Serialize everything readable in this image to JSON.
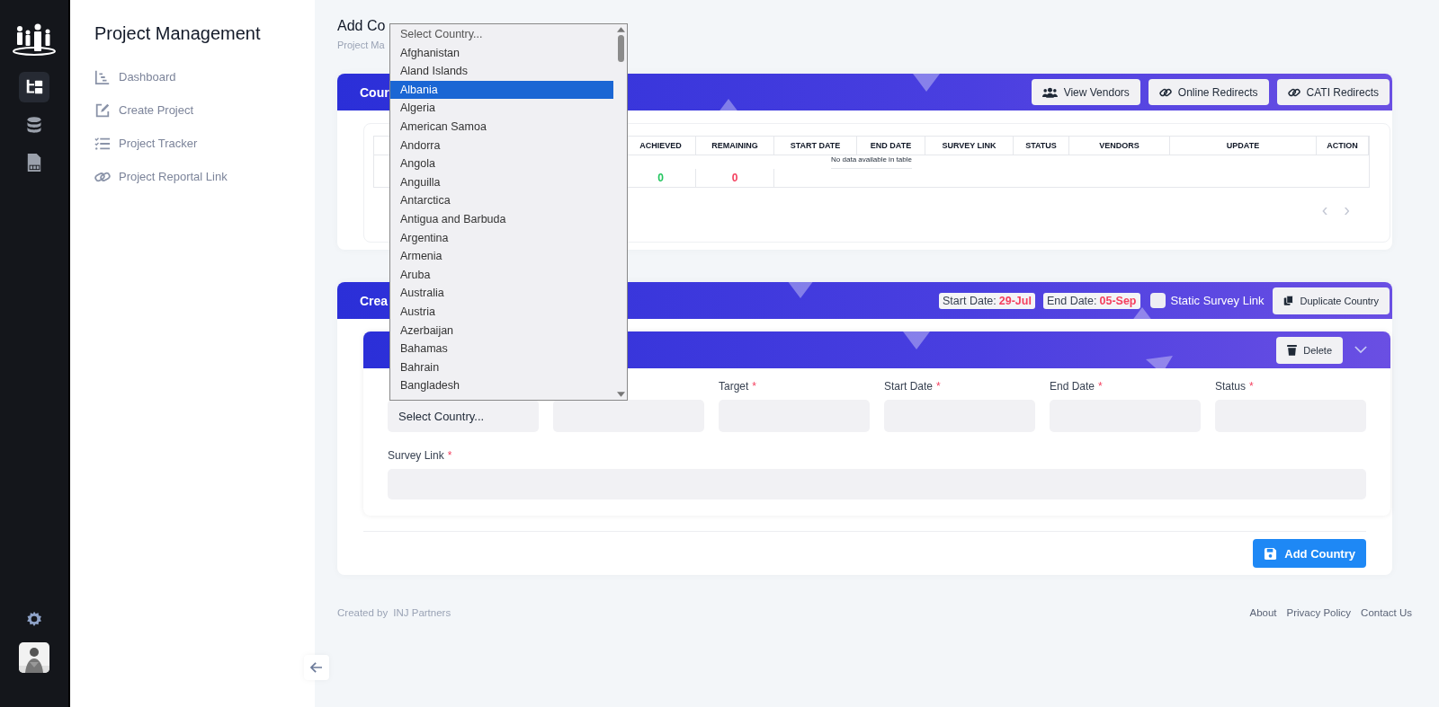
{
  "rail": {
    "items": [
      {
        "kind": "sitemap",
        "selected": true
      },
      {
        "kind": "database",
        "selected": false
      },
      {
        "kind": "pdf",
        "selected": false
      }
    ]
  },
  "sidebar": {
    "title": "Project Management",
    "items": [
      {
        "kind": "dashboard",
        "label": "Dashboard"
      },
      {
        "kind": "edit",
        "label": "Create Project"
      },
      {
        "kind": "tracker",
        "label": "Project Tracker"
      },
      {
        "kind": "link",
        "label": "Project Reportal Link"
      }
    ]
  },
  "page": {
    "title": "Add Co",
    "breadcrumb": "Project Ma"
  },
  "country_card": {
    "title": "Cour",
    "buttons": [
      {
        "kind": "users",
        "label": "View Vendors"
      },
      {
        "kind": "link",
        "label": "Online Redirects"
      },
      {
        "kind": "link",
        "label": "CATI Redirects"
      }
    ],
    "table": {
      "columns": [
        "",
        "ACHIEVED",
        "REMAINING",
        "START DATE",
        "END DATE",
        "SURVEY LINK",
        "STATUS",
        "VENDORS",
        "UPDATE",
        "ACTION"
      ],
      "empty_message": "No data available in table",
      "totals": [
        {
          "value": "0",
          "color": "#22c55e"
        },
        {
          "value": "0",
          "color": "#f43f5e"
        }
      ]
    },
    "pager": {
      "prev": "‹",
      "next": "›"
    }
  },
  "create_card": {
    "title": "Crea",
    "start_date": {
      "label": "Start Date:",
      "value": "29-Jul"
    },
    "end_date": {
      "label": "End Date:",
      "value": "05-Sep"
    },
    "static_link": {
      "label": "Static Survey Link",
      "checked": false
    },
    "duplicate_button": "Duplicate Country",
    "section": {
      "delete_button": "Delete",
      "fields": [
        {
          "kind": "select",
          "value": "Select Country..."
        },
        {
          "kind": "text"
        },
        {
          "kind": "text",
          "label": "Target",
          "required": "*"
        },
        {
          "kind": "date",
          "label": "Start Date",
          "required": "*"
        },
        {
          "kind": "date",
          "label": "End Date",
          "required": "*"
        },
        {
          "kind": "select",
          "label": "Status",
          "required": "*"
        }
      ],
      "survey_link": {
        "label": "Survey Link",
        "required": "*"
      }
    },
    "add_button": "Add Country"
  },
  "country_dropdown": {
    "options": [
      {
        "label": "Select Country...",
        "selected": false
      },
      {
        "label": "Afghanistan",
        "selected": false
      },
      {
        "label": "Aland Islands",
        "selected": false
      },
      {
        "label": "Albania",
        "selected": true
      },
      {
        "label": "Algeria",
        "selected": false
      },
      {
        "label": "American Samoa",
        "selected": false
      },
      {
        "label": "Andorra",
        "selected": false
      },
      {
        "label": "Angola",
        "selected": false
      },
      {
        "label": "Anguilla",
        "selected": false
      },
      {
        "label": "Antarctica",
        "selected": false
      },
      {
        "label": "Antigua and Barbuda",
        "selected": false
      },
      {
        "label": "Argentina",
        "selected": false
      },
      {
        "label": "Armenia",
        "selected": false
      },
      {
        "label": "Aruba",
        "selected": false
      },
      {
        "label": "Australia",
        "selected": false
      },
      {
        "label": "Austria",
        "selected": false
      },
      {
        "label": "Azerbaijan",
        "selected": false
      },
      {
        "label": "Bahamas",
        "selected": false
      },
      {
        "label": "Bahrain",
        "selected": false
      },
      {
        "label": "Bangladesh",
        "selected": false
      }
    ]
  },
  "footer": {
    "credit_prefix": "Created by",
    "credit_name": "INJ Partners",
    "links": [
      "About",
      "Privacy Policy",
      "Contact Us"
    ]
  }
}
